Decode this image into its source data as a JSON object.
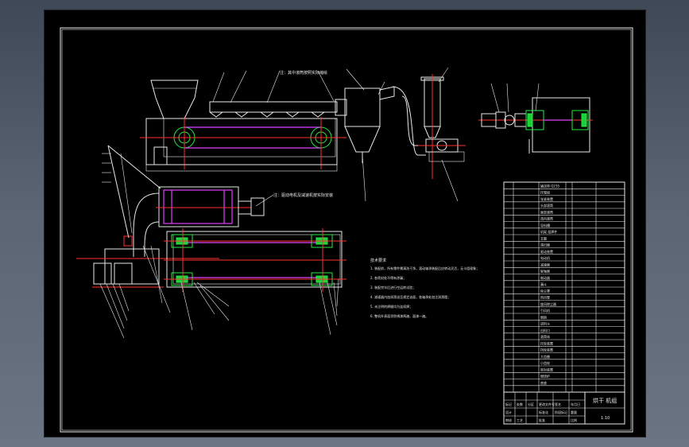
{
  "drawing": {
    "title_block_name": "烘干 机组",
    "top_callout": "注：其中滚筒按照实际缩绘",
    "motor_callout": "注：驱动电机及减速机按实际安装"
  },
  "tech_requirements": {
    "heading": "技术要求",
    "lines": [
      "1. 装配前，所有零件需清洗干净，滚动轴承装配后应转动灵活，无卡阻现象；",
      "2. 各密封处不得有渗漏；",
      "3. 装配完毕后进行空运转试验；",
      "4. 减速器内加润滑油至规定油面，各轴承处加注润滑脂；",
      "5. 未注明的焊缝均为连续焊；",
      "6. 整机外表面涂防锈漆两遍，面漆一遍。"
    ]
  },
  "parts_list": {
    "rows": [
      "输送带  Q235",
      "托辊组",
      "张紧装置",
      "头部滚筒",
      "尾部滚筒",
      "改向滚筒",
      "导料槽",
      "机架  组焊件",
      "支腿",
      "清扫器",
      "驱动装置",
      "电动机",
      "减速器",
      "联轴器",
      "制动器",
      "漏斗",
      "除尘罩",
      "热风管",
      "旋风除尘器",
      "引风机",
      "烟囱",
      "进料斗",
      "出料口",
      "滚筒体",
      "托轮装置",
      "挡轮装置",
      "大齿圈",
      "小齿轮",
      "密封装置",
      "燃烧炉",
      "底座"
    ]
  },
  "title_block": {
    "labels": [
      "标记",
      "处数",
      "分区",
      "更改文件号",
      "签名",
      "年月日",
      "设计",
      "标准化",
      "审核",
      "工艺",
      "批准",
      "阶段标记",
      "重量",
      "比例"
    ],
    "scale": "1:10"
  }
}
